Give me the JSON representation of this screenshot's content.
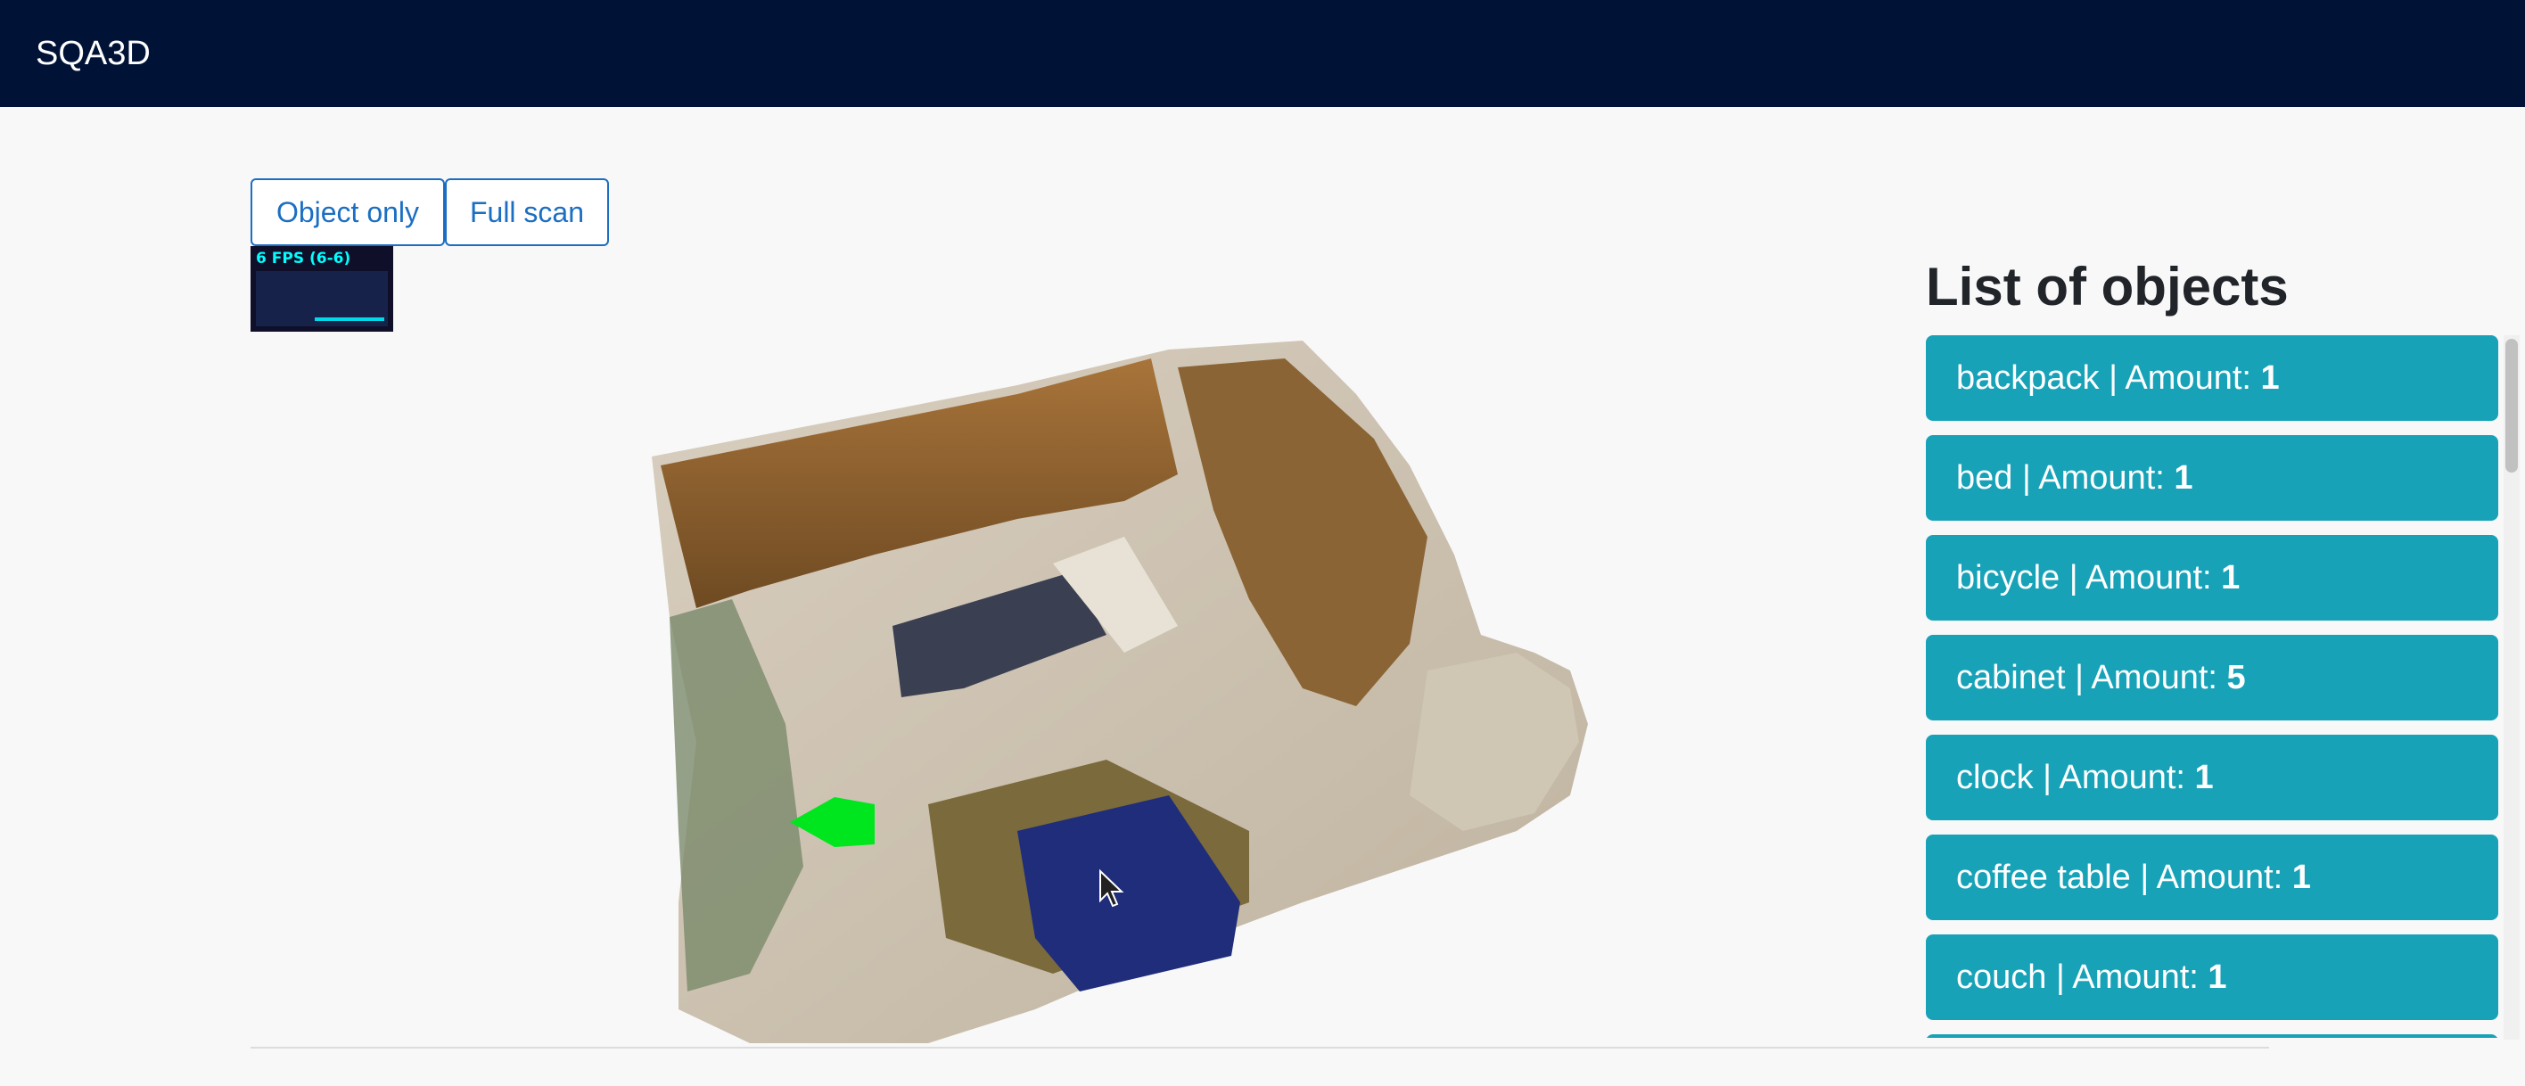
{
  "app": {
    "brand": "SQA3D"
  },
  "toolbar": {
    "object_only_label": "Object only",
    "full_scan_label": "Full scan"
  },
  "stats": {
    "fps_text": "6 FPS (6-6)"
  },
  "objects_panel": {
    "heading": "List of objects",
    "items": [
      {
        "name": "backpack",
        "separator": " | Amount: ",
        "amount": "1"
      },
      {
        "name": "bed",
        "separator": " | Amount: ",
        "amount": "1"
      },
      {
        "name": "bicycle",
        "separator": " | Amount: ",
        "amount": "1"
      },
      {
        "name": "cabinet",
        "separator": " | Amount: ",
        "amount": "5"
      },
      {
        "name": "clock",
        "separator": " | Amount: ",
        "amount": "1"
      },
      {
        "name": "coffee table",
        "separator": " | Amount: ",
        "amount": "1"
      },
      {
        "name": "couch",
        "separator": " | Amount: ",
        "amount": "1"
      },
      {
        "name": "",
        "separator": "",
        "amount": ""
      }
    ]
  },
  "colors": {
    "navbar": "#001336",
    "button_accent": "#1b6ec2",
    "list_item": "#17a2b8",
    "agent_arrow": "#00e61e"
  },
  "icons": {
    "agent_marker": "green-arrow-icon",
    "cursor": "mouse-pointer-icon"
  }
}
